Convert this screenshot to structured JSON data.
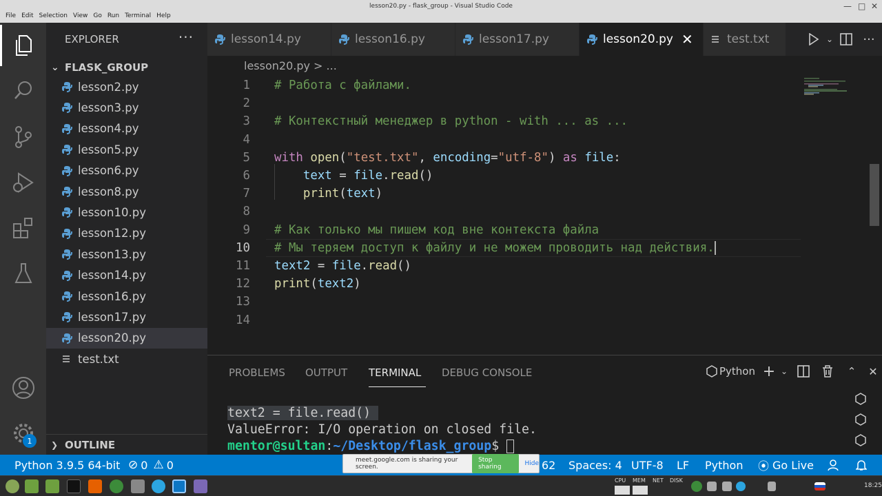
{
  "window": {
    "title": "lesson20.py - flask_group - Visual Studio Code"
  },
  "menubar": [
    "File",
    "Edit",
    "Selection",
    "View",
    "Go",
    "Run",
    "Terminal",
    "Help"
  ],
  "activity_bar": {
    "badge": "1"
  },
  "explorer": {
    "header": "EXPLORER",
    "more": "···",
    "folder": "FLASK_GROUP",
    "files": [
      "lesson2.py",
      "lesson3.py",
      "lesson4.py",
      "lesson5.py",
      "lesson6.py",
      "lesson8.py",
      "lesson10.py",
      "lesson12.py",
      "lesson13.py",
      "lesson14.py",
      "lesson16.py",
      "lesson17.py",
      "lesson20.py",
      "test.txt"
    ],
    "outline": "OUTLINE"
  },
  "tabs": [
    "lesson14.py",
    "lesson16.py",
    "lesson17.py",
    "lesson20.py",
    "test.txt"
  ],
  "breadcrumb": "lesson20.py > ...",
  "editor": {
    "line_numbers": [
      "1",
      "2",
      "3",
      "4",
      "5",
      "6",
      "7",
      "8",
      "9",
      "10",
      "11",
      "12",
      "13",
      "14"
    ],
    "line1": "# Работа с файлами.",
    "line3": "# Контекстный менеджер в python - with ... as ...",
    "line5": {
      "kw_with": "with",
      "fn_open": "open",
      "p1": "(",
      "str1": "\"test.txt\"",
      "comma": ", ",
      "param": "encoding",
      "eq": "=",
      "str2": "\"utf-8\"",
      "p2": ") ",
      "kw_as": "as",
      "var_file": "file",
      "colon": ":"
    },
    "line6": {
      "var_text": "text",
      "op": " = ",
      "var_file": "file",
      "dot": ".",
      "fn_read": "read",
      "parens": "()"
    },
    "line7": {
      "fn_print": "print",
      "p1": "(",
      "var_text": "text",
      "p2": ")"
    },
    "line9": "# Как только мы пишем код вне контекста файла",
    "line10": "# Мы теряем доступ к файлу и не можем проводить над действия.",
    "line11": {
      "var_text2": "text2",
      "op": " = ",
      "var_file": "file",
      "dot": ".",
      "fn_read": "read",
      "parens": "()"
    },
    "line12": {
      "fn_print": "print",
      "p1": "(",
      "var_text2": "text2",
      "p2": ")"
    }
  },
  "panel": {
    "tabs": [
      "PROBLEMS",
      "OUTPUT",
      "TERMINAL",
      "DEBUG CONSOLE"
    ],
    "shell": "Python",
    "terminal": {
      "line1": "text2 = file.read() ",
      "line2": "ValueError: I/O operation on closed file.",
      "prompt_user": "mentor@sultan",
      "prompt_colon": ":",
      "prompt_path": "~/Desktop/flask_group",
      "prompt_sign": "$ "
    }
  },
  "statusbar": {
    "python": "Python 3.9.5 64-bit",
    "errors": "0",
    "warnings": "0",
    "col_partial": "62",
    "spaces": "Spaces: 4",
    "encoding": "UTF-8",
    "eol": "LF",
    "language": "Python",
    "golive": "Go Live"
  },
  "share_banner": {
    "text": "meet.google.com is sharing your screen.",
    "stop": "Stop sharing",
    "hide": "Hide"
  },
  "taskbar": {
    "cpu": "CPU",
    "mem": "MEM",
    "net": "NET",
    "disk": "DISK",
    "time": "18:25"
  }
}
